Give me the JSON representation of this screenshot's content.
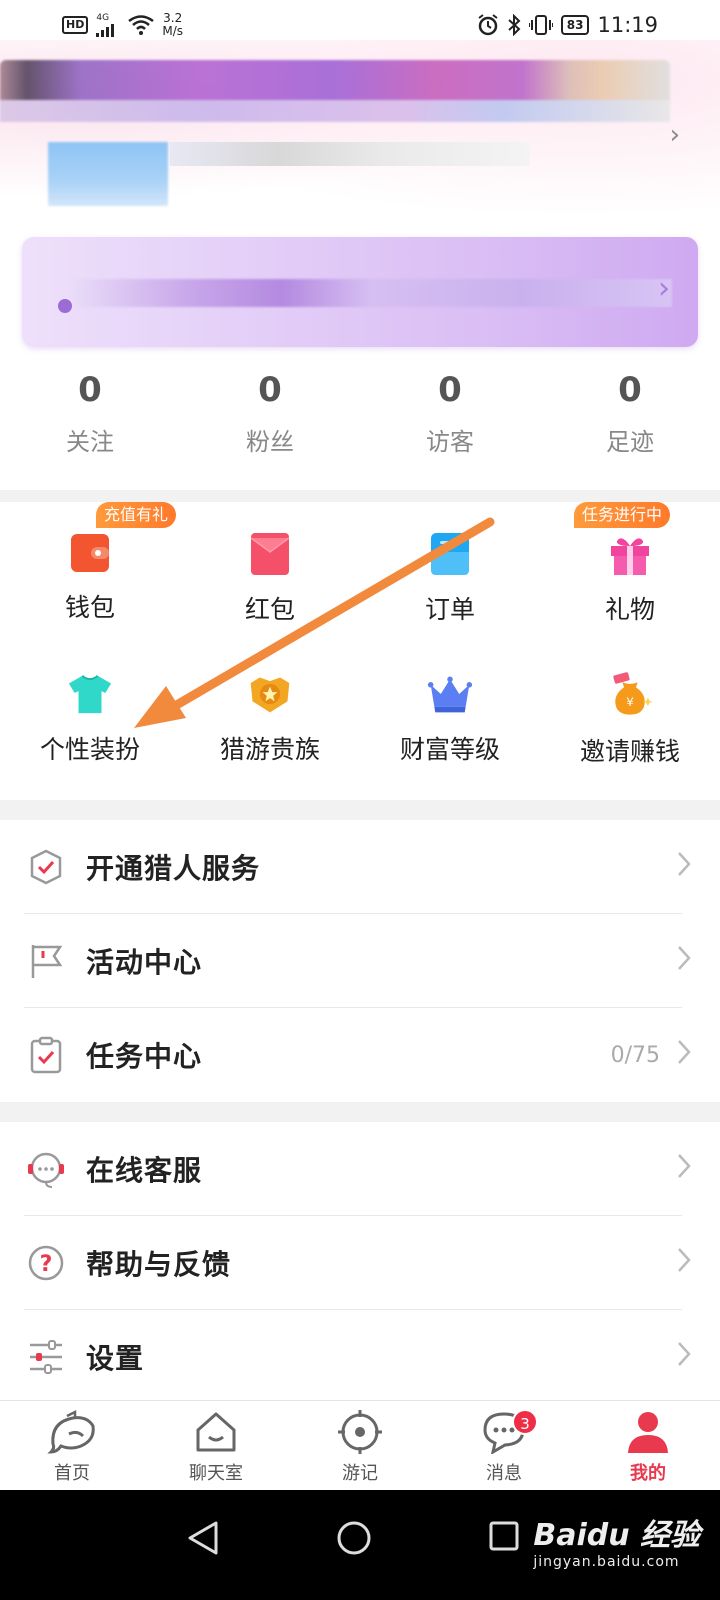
{
  "status_bar": {
    "hd": "HD",
    "network": "4G",
    "speed_value": "3.2",
    "speed_unit": "M/s",
    "battery": "83",
    "time": "11:19"
  },
  "stats": [
    {
      "value": "0",
      "label": "关注"
    },
    {
      "value": "0",
      "label": "粉丝"
    },
    {
      "value": "0",
      "label": "访客"
    },
    {
      "value": "0",
      "label": "足迹"
    }
  ],
  "grid": {
    "row1": [
      {
        "label": "钱包",
        "icon": "wallet-icon",
        "tag": "充值有礼"
      },
      {
        "label": "红包",
        "icon": "red-envelope-icon"
      },
      {
        "label": "订单",
        "icon": "order-icon"
      },
      {
        "label": "礼物",
        "icon": "gift-icon",
        "tag": "任务进行中"
      }
    ],
    "row2": [
      {
        "label": "个性装扮",
        "icon": "tshirt-icon"
      },
      {
        "label": "猎游贵族",
        "icon": "noble-badge-icon"
      },
      {
        "label": "财富等级",
        "icon": "crown-icon"
      },
      {
        "label": "邀请赚钱",
        "icon": "money-bag-icon"
      }
    ]
  },
  "menu_group1": [
    {
      "label": "开通猎人服务",
      "icon": "shield-check-icon"
    },
    {
      "label": "活动中心",
      "icon": "flag-icon"
    },
    {
      "label": "任务中心",
      "icon": "clipboard-check-icon",
      "value": "0/75"
    }
  ],
  "menu_group2": [
    {
      "label": "在线客服",
      "icon": "headset-icon"
    },
    {
      "label": "帮助与反馈",
      "icon": "help-icon"
    },
    {
      "label": "设置",
      "icon": "settings-sliders-icon"
    }
  ],
  "tabs": [
    {
      "label": "首页",
      "icon": "home-dolphin-icon"
    },
    {
      "label": "聊天室",
      "icon": "chatroom-house-icon"
    },
    {
      "label": "游记",
      "icon": "compass-icon"
    },
    {
      "label": "消息",
      "icon": "message-icon",
      "badge": "3"
    },
    {
      "label": "我的",
      "icon": "profile-icon",
      "active": true
    }
  ],
  "watermark": {
    "logo": "Baidu 经验",
    "sub": "jingyan.baidu.com"
  },
  "colors": {
    "accent_red": "#e9394f",
    "tag_orange": "#ff8a33",
    "arrow_orange": "#f28a3e",
    "banner_purple": "#d9bdf4"
  }
}
